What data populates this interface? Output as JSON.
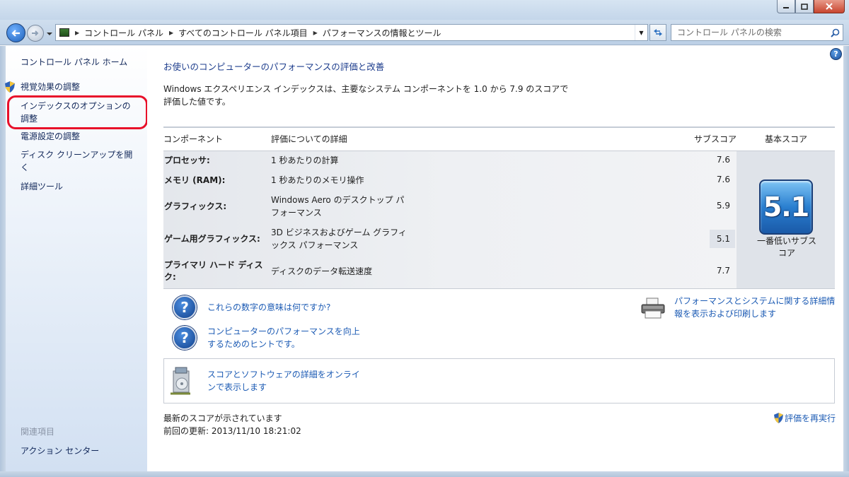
{
  "window": {
    "controls": [
      "minimize",
      "maximize",
      "close"
    ]
  },
  "address_bar": {
    "breadcrumbs": [
      "コントロール パネル",
      "すべてのコントロール パネル項目",
      "パフォーマンスの情報とツール"
    ]
  },
  "search": {
    "placeholder": "コントロール パネルの検索"
  },
  "sidebar": {
    "home": "コントロール パネル ホーム",
    "items": [
      {
        "label": "視覚効果の調整",
        "shield": true
      },
      {
        "label_line1": "インデックスのオプションの",
        "label_line2": "調整",
        "highlighted": true
      },
      {
        "label": "電源設定の調整"
      },
      {
        "label_line1": "ディスク クリーンアップを開",
        "label_line2": "く"
      },
      {
        "label": "詳細ツール"
      }
    ],
    "related_heading": "関連項目",
    "related_items": [
      "アクション センター"
    ]
  },
  "main": {
    "title": "お使いのコンピューターのパフォーマンスの評価と改善",
    "intro_line1": "Windows エクスペリエンス インデックスは、主要なシステム コンポーネントを 1.0 から 7.9 のスコアで",
    "intro_line2": "評価した値です。",
    "table": {
      "headers": {
        "component": "コンポーネント",
        "detail": "評価についての詳細",
        "subscore": "サブスコア",
        "base": "基本スコア"
      },
      "rows": [
        {
          "component": "プロセッサ:",
          "detail": "1 秒あたりの計算",
          "score": "7.6"
        },
        {
          "component": "メモリ (RAM):",
          "detail": "1 秒あたりのメモリ操作",
          "score": "7.6"
        },
        {
          "component": "グラフィックス:",
          "detail_line1": "Windows Aero のデスクトップ パ",
          "detail_line2": "フォーマンス",
          "score": "5.9"
        },
        {
          "component": "ゲーム用グラフィックス:",
          "detail_line1": "3D ビジネスおよびゲーム グラフィ",
          "detail_line2": "ックス パフォーマンス",
          "score": "5.1",
          "lowest": true
        },
        {
          "component_line1": "プライマリ ハード ディス",
          "component_line2": "ク:",
          "detail": "ディスクのデータ転送速度",
          "score": "7.7"
        }
      ],
      "base_score": "5.1",
      "base_label_line1": "一番低いサブス",
      "base_label_line2": "コア"
    },
    "links": {
      "meaning": "これらの数字の意味は何ですか?",
      "tips_line1": "コンピューターのパフォーマンスを向上",
      "tips_line2": "するためのヒントです。",
      "print_line1": "パフォーマンスとシステムに関する詳細情",
      "print_line2": "報を表示および印刷します",
      "online_line1": "スコアとソフトウェアの詳細をオンライ",
      "online_line2": "ンで表示します"
    },
    "status": {
      "latest": "最新のスコアが示されています",
      "last_update": "前回の更新: 2013/11/10 18:21:02",
      "rerun": "評価を再実行"
    }
  },
  "colors": {
    "link": "#1c5bb4",
    "highlight_border": "#e8102a",
    "badge_blue": "#2a7fd0"
  }
}
